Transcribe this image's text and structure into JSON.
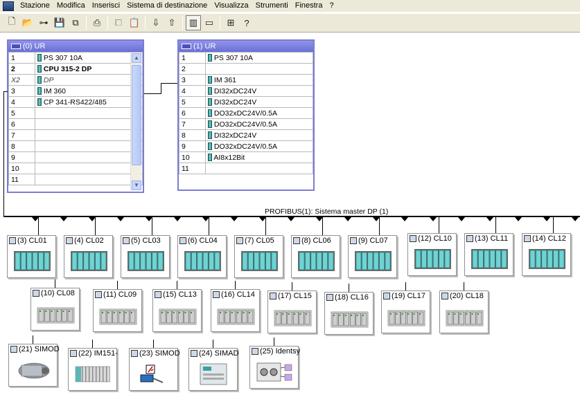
{
  "menu": [
    "Stazione",
    "Modifica",
    "Inserisci",
    "Sistema di destinazione",
    "Visualizza",
    "Strumenti",
    "Finestra",
    "?"
  ],
  "racks": [
    {
      "title": "(0) UR",
      "rows": [
        {
          "slot": "1",
          "module": "PS 307 10A",
          "style": "normal"
        },
        {
          "slot": "2",
          "module": "CPU 315-2 DP",
          "style": "bold"
        },
        {
          "slot": "X2",
          "module": "DP",
          "style": "italic"
        },
        {
          "slot": "3",
          "module": "IM 360",
          "style": "normal"
        },
        {
          "slot": "4",
          "module": "CP 341-RS422/485",
          "style": "normal"
        },
        {
          "slot": "5",
          "module": "",
          "style": "normal"
        },
        {
          "slot": "6",
          "module": "",
          "style": "normal"
        },
        {
          "slot": "7",
          "module": "",
          "style": "normal"
        },
        {
          "slot": "8",
          "module": "",
          "style": "normal"
        },
        {
          "slot": "9",
          "module": "",
          "style": "normal"
        },
        {
          "slot": "10",
          "module": "",
          "style": "normal"
        },
        {
          "slot": "11",
          "module": "",
          "style": "normal"
        }
      ]
    },
    {
      "title": "(1) UR",
      "rows": [
        {
          "slot": "1",
          "module": "PS 307 10A"
        },
        {
          "slot": "2",
          "module": ""
        },
        {
          "slot": "3",
          "module": "IM 361"
        },
        {
          "slot": "4",
          "module": "DI32xDC24V"
        },
        {
          "slot": "5",
          "module": "DI32xDC24V"
        },
        {
          "slot": "6",
          "module": "DO32xDC24V/0.5A"
        },
        {
          "slot": "7",
          "module": "DO32xDC24V/0.5A"
        },
        {
          "slot": "8",
          "module": "DI32xDC24V"
        },
        {
          "slot": "9",
          "module": "DO32xDC24V/0.5A"
        },
        {
          "slot": "10",
          "module": "AI8x12Bit"
        },
        {
          "slot": "11",
          "module": ""
        }
      ]
    }
  ],
  "bus": {
    "label": "PROFIBUS(1): Sistema master DP (1)"
  },
  "stations": [
    {
      "label": "(3) CL01",
      "kind": "s7"
    },
    {
      "label": "(4) CL02",
      "kind": "s7"
    },
    {
      "label": "(5) CL03",
      "kind": "s7"
    },
    {
      "label": "(6) CL04",
      "kind": "s7"
    },
    {
      "label": "(7) CL05",
      "kind": "s7"
    },
    {
      "label": "(8) CL06",
      "kind": "s7"
    },
    {
      "label": "(9) CL07",
      "kind": "s7"
    },
    {
      "label": "(12) CL10",
      "kind": "s7"
    },
    {
      "label": "(13) CL11",
      "kind": "s7"
    },
    {
      "label": "(14) CL12",
      "kind": "s7"
    },
    {
      "label": "(10) CL08",
      "kind": "et"
    },
    {
      "label": "(11) CL09",
      "kind": "et"
    },
    {
      "label": "(15) CL13",
      "kind": "et"
    },
    {
      "label": "(16) CL14",
      "kind": "et"
    },
    {
      "label": "(17) CL15",
      "kind": "et"
    },
    {
      "label": "(18) CL16",
      "kind": "et"
    },
    {
      "label": "(19) CL17",
      "kind": "et"
    },
    {
      "label": "(20) CL18",
      "kind": "et"
    },
    {
      "label": "(21) SIMOD",
      "kind": "motor"
    },
    {
      "label": "(22) IM151-",
      "kind": "im151"
    },
    {
      "label": "(23) SIMOD",
      "kind": "sensor"
    },
    {
      "label": "(24) SIMAD",
      "kind": "simad"
    },
    {
      "label": "(25) Identsy",
      "kind": "ident"
    }
  ],
  "colors": {
    "rackTitle": "#7b7bd6",
    "module": "#2f8f8f",
    "bus": "#000000"
  }
}
